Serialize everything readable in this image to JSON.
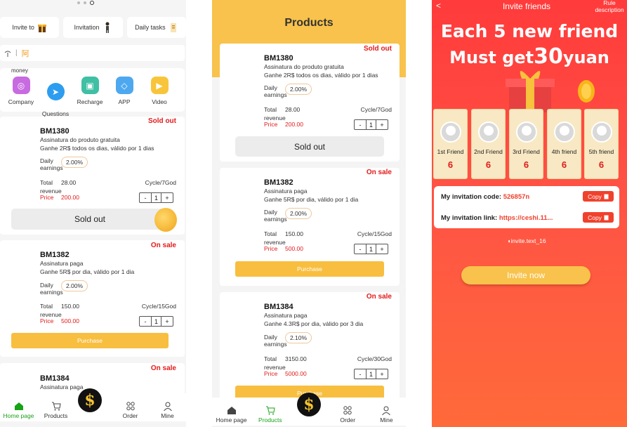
{
  "panel1": {
    "quick": [
      {
        "label": "Invite to",
        "icon": "gift-icon"
      },
      {
        "label": "Invitation",
        "icon": "person-icon"
      },
      {
        "label": "Daily tasks",
        "icon": "tasks-icon"
      }
    ],
    "notice": {
      "sep": "|",
      "mark": "阿"
    },
    "money_label": "money",
    "grid": [
      {
        "label": "Company",
        "color": "#c86be0",
        "icon": "company-icon"
      },
      {
        "label": "Questions\nand\nanswers",
        "color": "#2d9df0",
        "icon": "telegram-icon"
      },
      {
        "label": "Recharge",
        "color": "#3fbfa3",
        "icon": "wallet-icon"
      },
      {
        "label": "APP",
        "color": "#4da8f0",
        "icon": "cube-icon"
      },
      {
        "label": "Video",
        "color": "#f8c53a",
        "icon": "video-icon"
      }
    ],
    "products": [
      {
        "code": "BM1380",
        "status": "Sold out",
        "line1": "Assinatura do produto gratuita",
        "line2": "Ganhe 2R$ todos os dias, válido por 1 dias",
        "daily_label": "Daily earnings",
        "pct": "2.00%",
        "total_label": "Total",
        "total": "28.00",
        "cycle": "Cycle/7God",
        "revenue": "revenue",
        "price_label": "Price",
        "price": "200.00",
        "qty": "1",
        "button": "Sold out"
      },
      {
        "code": "BM1382",
        "status": "On sale",
        "line1": "Assinatura paga",
        "line2": "Ganhe 5R$ por dia, válido por 1 dia",
        "daily_label": "Daily earnings",
        "pct": "2.00%",
        "total_label": "Total",
        "total": "150.00",
        "cycle": "Cycle/15God",
        "revenue": "revenue",
        "price_label": "Price",
        "price": "500.00",
        "qty": "1",
        "button": "Purchase"
      },
      {
        "code": "BM1384",
        "status": "On sale",
        "line1": "Assinatura paga"
      }
    ],
    "tabs": [
      {
        "label": "Home page",
        "icon": "home-icon"
      },
      {
        "label": "Products",
        "icon": "cart-icon"
      },
      {
        "label": "",
        "icon": "dollar-icon"
      },
      {
        "label": "Order",
        "icon": "order-icon"
      },
      {
        "label": "Mine",
        "icon": "user-icon"
      }
    ],
    "dollar": "$"
  },
  "panel2": {
    "title": "Products",
    "products": [
      {
        "code": "BM1380",
        "status": "Sold out",
        "line1": "Assinatura do produto gratuita",
        "line2": "Ganhe 2R$ todos os dias, válido por 1 dias",
        "daily_label": "Daily earnings",
        "pct": "2.00%",
        "total_label": "Total",
        "total": "28.00",
        "cycle": "Cycle/7God",
        "revenue": "revenue",
        "price_label": "Price",
        "price": "200.00",
        "qty": "1",
        "button": "Sold out"
      },
      {
        "code": "BM1382",
        "status": "On sale",
        "line1": "Assinatura paga",
        "line2": "Ganhe 5R$ por dia, válido por 1 dia",
        "daily_label": "Daily earnings",
        "pct": "2.00%",
        "total_label": "Total",
        "total": "150.00",
        "cycle": "Cycle/15God",
        "revenue": "revenue",
        "price_label": "Price",
        "price": "500.00",
        "qty": "1",
        "button": "Purchase"
      },
      {
        "code": "BM1384",
        "status": "On sale",
        "line1": "Assinatura paga",
        "line2": "Ganhe 4.3R$ por dia, válido por 3 dia",
        "daily_label": "Daily earnings",
        "pct": "2.10%",
        "total_label": "Total",
        "total": "3150.00",
        "cycle": "Cycle/30God",
        "revenue": "revenue",
        "price_label": "Price",
        "price": "5000.00",
        "qty": "1",
        "button": "Purchase"
      }
    ],
    "tabs": [
      {
        "label": "Home page",
        "icon": "home-icon"
      },
      {
        "label": "Products",
        "icon": "cart-icon"
      },
      {
        "label": "",
        "icon": "dollar-icon"
      },
      {
        "label": "Order",
        "icon": "order-icon"
      },
      {
        "label": "Mine",
        "icon": "user-icon"
      }
    ],
    "dollar": "$"
  },
  "panel3": {
    "back": "<",
    "title": "Invite friends",
    "rule": "Rule description",
    "hero_line1": "Each 5 new friend",
    "hero_line2_pre": "Must get",
    "hero_amount": "30",
    "hero_unit": "yuan",
    "friends": [
      {
        "label": "1st Friend",
        "count": "6"
      },
      {
        "label": "2nd Friend",
        "count": "6"
      },
      {
        "label": "3rd Friend",
        "count": "6"
      },
      {
        "label": "4th friend",
        "count": "6"
      },
      {
        "label": "5th friend",
        "count": "6"
      }
    ],
    "code_label": "My invitation code:",
    "code_value": "526857n",
    "link_label": "My invitation link:",
    "link_value": "https://ceshi.11...",
    "copy": "Copy",
    "invite_text": "invite.text_16",
    "invite_now": "Invite now"
  }
}
